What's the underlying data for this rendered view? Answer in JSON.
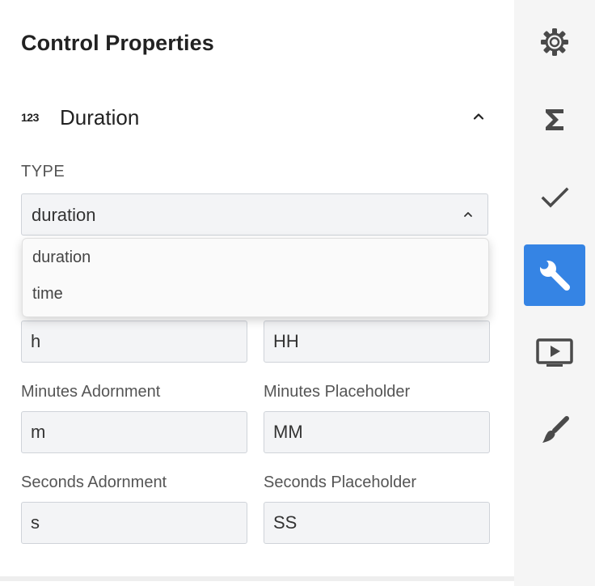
{
  "panel": {
    "title": "Control Properties"
  },
  "section": {
    "type_icon_text": "123",
    "title": "Duration",
    "collapse_icon": "chevron-up-icon"
  },
  "type_field": {
    "label": "TYPE",
    "value": "duration",
    "options": [
      "duration",
      "time"
    ]
  },
  "fields": {
    "hours_adornment": {
      "value": "h"
    },
    "hours_placeholder": {
      "value": "HH"
    },
    "minutes_adornment": {
      "label": "Minutes Adornment",
      "value": "m"
    },
    "minutes_placeholder": {
      "label": "Minutes Placeholder",
      "value": "MM"
    },
    "seconds_adornment": {
      "label": "Seconds Adornment",
      "value": "s"
    },
    "seconds_placeholder": {
      "label": "Seconds Placeholder",
      "value": "SS"
    }
  },
  "sidebar": {
    "items": [
      {
        "name": "settings",
        "icon": "gear-icon",
        "active": false
      },
      {
        "name": "calculations",
        "icon": "sigma-icon",
        "active": false
      },
      {
        "name": "validation",
        "icon": "checkmark-icon",
        "active": false
      },
      {
        "name": "properties",
        "icon": "wrench-icon",
        "active": true
      },
      {
        "name": "preview",
        "icon": "play-screen-icon",
        "active": false
      },
      {
        "name": "style",
        "icon": "paintbrush-icon",
        "active": false
      }
    ]
  },
  "colors": {
    "accent": "#3584e4",
    "sidebar_bg": "#f5f5f5",
    "input_bg": "#f3f4f6",
    "input_border": "#cfd3d9",
    "icon_gray": "#4a4a4a"
  }
}
